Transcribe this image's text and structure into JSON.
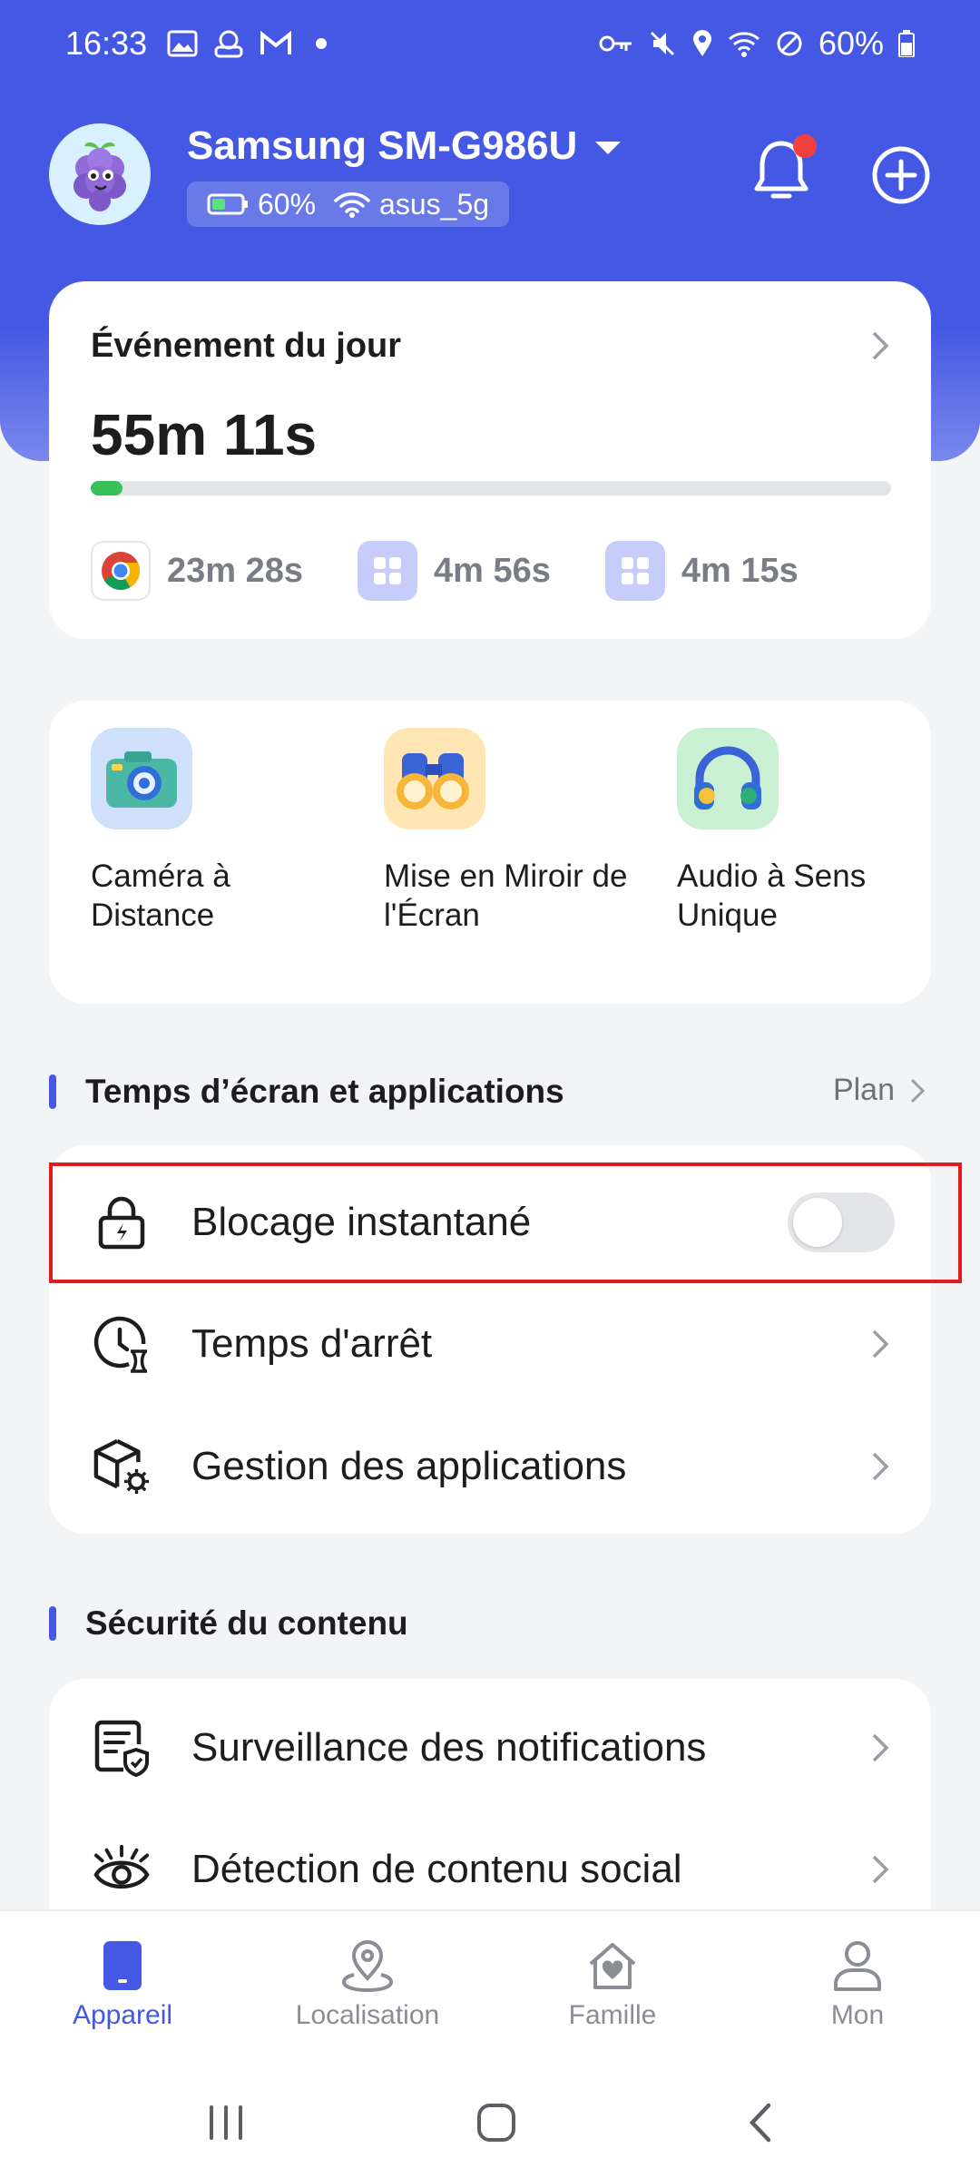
{
  "status_bar": {
    "time": "16:33",
    "battery": "60%"
  },
  "header": {
    "device_name": "Samsung SM-G986U",
    "battery": "60%",
    "wifi": "asus_5g"
  },
  "event_card": {
    "title": "Événement du jour",
    "total_time": "55m 11s",
    "progress_fraction": 0.04,
    "apps": [
      {
        "icon": "chrome-icon",
        "time": "23m 28s"
      },
      {
        "icon": "app-grid-icon",
        "time": "4m 56s"
      },
      {
        "icon": "app-grid-icon",
        "time": "4m 15s"
      }
    ]
  },
  "features": [
    {
      "icon": "camera-icon",
      "label": "Caméra à Distance"
    },
    {
      "icon": "binoculars-icon",
      "label": "Mise en Miroir de l'Écran"
    },
    {
      "icon": "headphones-icon",
      "label": "Audio à Sens Unique"
    }
  ],
  "screen_time_section": {
    "title": "Temps d’écran et applications",
    "plan_label": "Plan",
    "rows": [
      {
        "icon": "lock-icon",
        "label": "Blocage instantané",
        "toggle_on": false
      },
      {
        "icon": "clock-icon",
        "label": "Temps d'arrêt"
      },
      {
        "icon": "app-management-icon",
        "label": "Gestion des applications"
      }
    ]
  },
  "content_safety_section": {
    "title": "Sécurité du contenu",
    "rows": [
      {
        "icon": "notification-shield-icon",
        "label": "Surveillance des notifications"
      },
      {
        "icon": "eye-icon",
        "label": "Détection de contenu social"
      }
    ]
  },
  "bottom_nav": [
    {
      "icon": "phone-icon",
      "label": "Appareil",
      "active": true
    },
    {
      "icon": "location-icon",
      "label": "Localisation",
      "active": false
    },
    {
      "icon": "home-heart-icon",
      "label": "Famille",
      "active": false
    },
    {
      "icon": "person-icon",
      "label": "Mon",
      "active": false
    }
  ],
  "colors": {
    "primary": "#4558e3",
    "progress": "#38c05a",
    "highlight": "#e01c1c",
    "notification_dot": "#f04040"
  }
}
